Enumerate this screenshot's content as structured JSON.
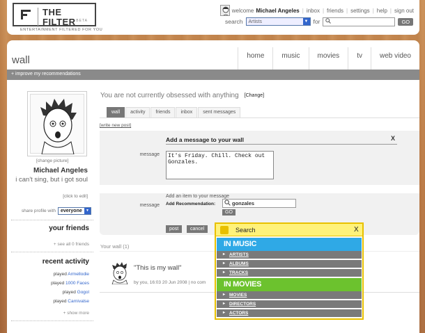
{
  "header": {
    "logo_text": "THE FILTER",
    "logo_beta": "BETA",
    "tagline": "ENTERTAINMENT FILTERED FOR YOU",
    "welcome": "welcome",
    "user_name": "Michael Angeles",
    "links": [
      "inbox",
      "friends",
      "settings",
      "help",
      "sign out"
    ],
    "search_label": "search",
    "search_category": "Artists",
    "for_label": "for",
    "search_value": "",
    "go_label": "GO"
  },
  "main": {
    "title": "wall",
    "nav": [
      "home",
      "music",
      "movies",
      "tv",
      "web video"
    ],
    "improve_link": "+ improve my recommendations"
  },
  "profile": {
    "change_picture": "[change picture]",
    "name": "Michael Angeles",
    "status": "i can't sing, but i got soul",
    "click_edit": "[click to edit]",
    "share_label": "share profile with",
    "share_value": "everyone",
    "friends_title": "your friends",
    "see_all_friends": "+ see all 0 friends",
    "activity_title": "recent activity",
    "activity_verb": "played",
    "activity_items": [
      "Armellodie",
      "1000 Faces",
      "Gogol",
      "Carnivalse"
    ],
    "show_more": "+ show more"
  },
  "content": {
    "obsessed_text": "You are not currently obsessed with anything",
    "change_label": "[Change]",
    "tabs": [
      "wall",
      "activity",
      "friends",
      "inbox",
      "sent messages"
    ],
    "write_post": "[write new post]"
  },
  "form": {
    "title": "Add a message to your wall",
    "close": "X",
    "message_label": "message",
    "message_value": "It's Friday. Chill. Check out Gonzales.",
    "add_item": "Add an item to your message",
    "add_rec_label": "Add Recommendation:",
    "rec_value": "gonzales",
    "go_label": "GO",
    "post_label": "post",
    "cancel_label": "cancel"
  },
  "wall": {
    "header": "Your wall (1)",
    "post_text": "\"This is my wall\"",
    "post_meta": "by you, 16:03 20 Jun 2008 | no com"
  },
  "popup": {
    "title": "Search",
    "close": "X",
    "music_heading": "IN MUSIC",
    "music_items": [
      "ARTISTS",
      "ALBUMS",
      "TRACKS"
    ],
    "movies_heading": "IN MOVIES",
    "movies_items": [
      "MOVIES",
      "DIRECTORS",
      "ACTORS"
    ]
  },
  "colors": {
    "music": "#2fa9e6",
    "movies": "#6cc22e",
    "popup_border": "#e8c000",
    "bar_gray": "#8a8a8a"
  }
}
